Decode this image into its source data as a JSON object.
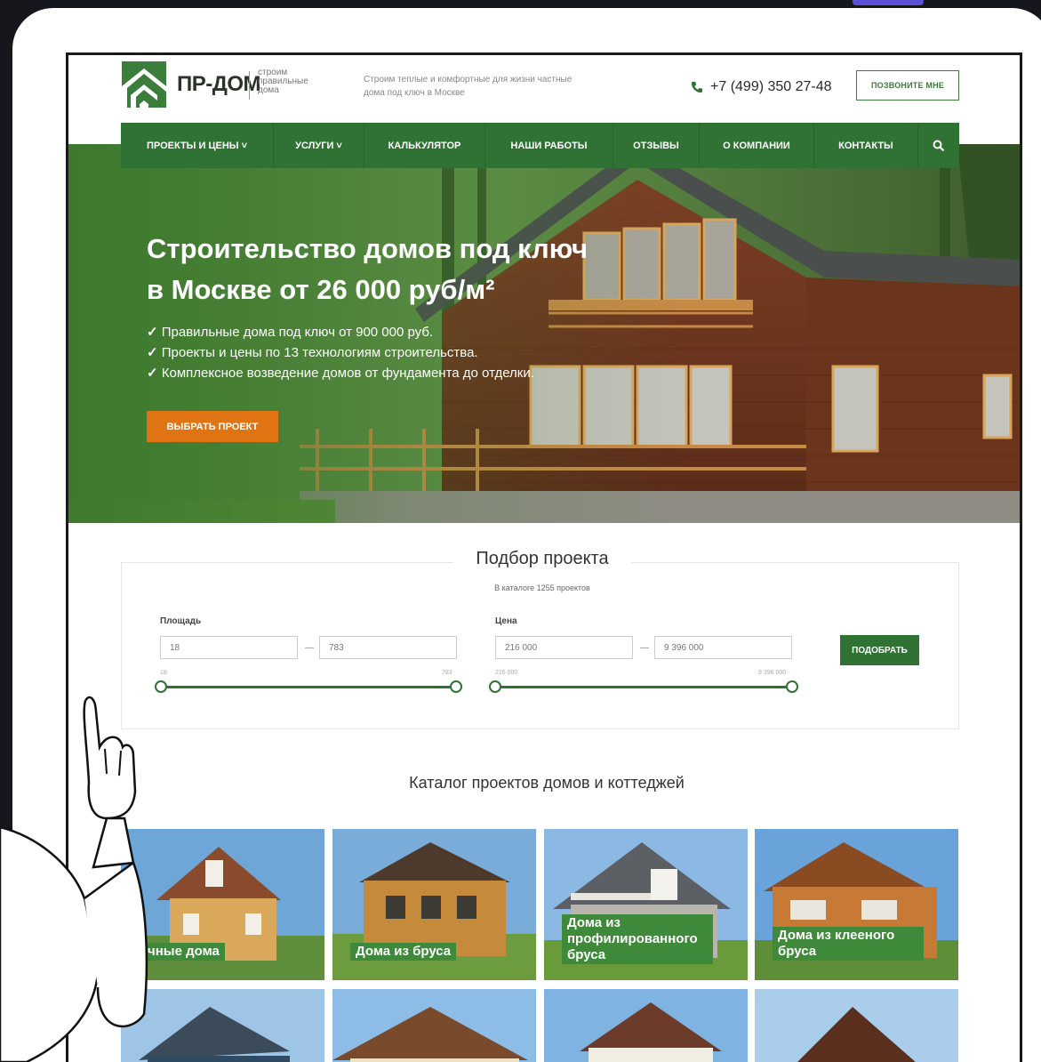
{
  "header": {
    "logo_name": "ПР-ДОМ",
    "logo_tagline": [
      "строим",
      "правильные",
      "дома"
    ],
    "description": "Строим теплые и комфортные для жизни частные дома под ключ в Москве",
    "phone": "+7 (499) 350 27-48",
    "callback_label": "позвоните мне"
  },
  "nav": {
    "items": [
      {
        "label": "ПРОЕКТЫ И ЦЕНЫ ˅"
      },
      {
        "label": "УСЛУГИ ˅"
      },
      {
        "label": "КАЛЬКУЛЯТОР"
      },
      {
        "label": "НАШИ РАБОТЫ"
      },
      {
        "label": "ОТЗЫВЫ"
      },
      {
        "label": "О КОМПАНИИ"
      },
      {
        "label": "КОНТАКТЫ"
      }
    ],
    "search_icon": "search-icon"
  },
  "hero": {
    "title_line1": "Строительство домов под ключ",
    "title_line2": "в Москве от 26 000 руб/м²",
    "bullets": [
      "Правильные дома под ключ от 900 000 руб.",
      "Проекты и цены по 13 технологиям строительства.",
      "Комплексное возведение домов от фундамента до отделки."
    ],
    "button_label": "ВЫБРАТЬ ПРОЕКТ"
  },
  "selector": {
    "title": "Подбор проекта",
    "subtitle": "В каталоге 1255 проектов",
    "area": {
      "label": "Площадь",
      "from": "18",
      "to": "783",
      "min": "18",
      "max": "783"
    },
    "price": {
      "label": "Цена",
      "from": "216 000",
      "to": "9 396 000",
      "min": "216 000",
      "max": "9 396 000"
    },
    "button_label": "ПОДОБРАТЬ"
  },
  "catalog": {
    "title": "Каталог проектов домов и коттеджей",
    "cards": [
      {
        "label": "Каркасные дома",
        "visible_label": "чные дома"
      },
      {
        "label": "Дома из бруса"
      },
      {
        "label": "Дома из профилированного бруса"
      },
      {
        "label": "Дома из клееного бруса"
      }
    ]
  },
  "colors": {
    "brand_green": "#2f7233",
    "accent_orange": "#e07412",
    "label_green": "#3f8a3a"
  }
}
